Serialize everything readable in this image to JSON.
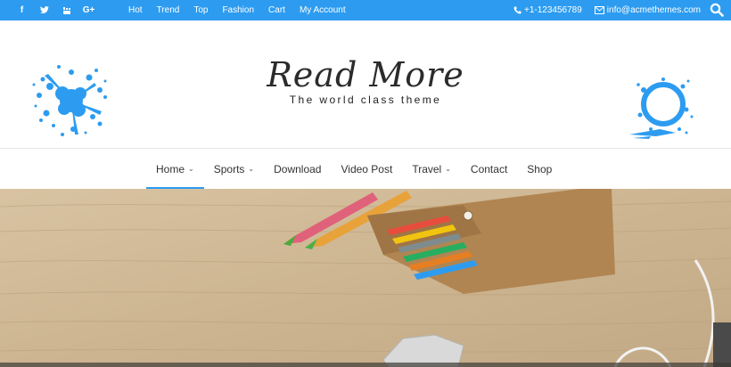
{
  "topbar": {
    "social": [
      {
        "icon": "facebook-icon",
        "glyph": "f"
      },
      {
        "icon": "twitter-icon",
        "glyph": "t"
      },
      {
        "icon": "youtube-icon",
        "glyph": "▶"
      },
      {
        "icon": "google-plus-icon",
        "glyph": "G+"
      }
    ],
    "links": [
      "Hot",
      "Trend",
      "Top",
      "Fashion",
      "Cart",
      "My Account"
    ],
    "phone": "+1-123456789",
    "email": "info@acmethemes.com",
    "bg_color": "#2d9cf0"
  },
  "header": {
    "site_title": "Read More",
    "tagline": "The world class theme",
    "accent_color": "#2d9cf0"
  },
  "nav": {
    "items": [
      {
        "label": "Home",
        "has_dropdown": true,
        "active": true
      },
      {
        "label": "Sports",
        "has_dropdown": true,
        "active": false
      },
      {
        "label": "Download",
        "has_dropdown": false,
        "active": false
      },
      {
        "label": "Video Post",
        "has_dropdown": false,
        "active": false
      },
      {
        "label": "Travel",
        "has_dropdown": true,
        "active": false
      },
      {
        "label": "Contact",
        "has_dropdown": false,
        "active": false
      },
      {
        "label": "Shop",
        "has_dropdown": false,
        "active": false
      }
    ],
    "caret_glyph": "⌄"
  }
}
